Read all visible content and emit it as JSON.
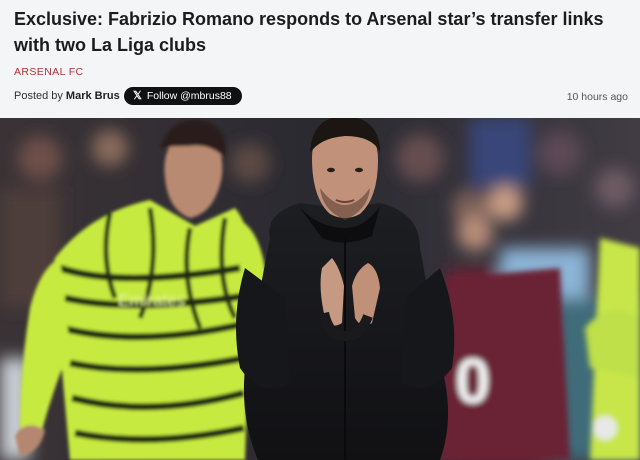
{
  "article": {
    "headline": "Exclusive: Fabrizio Romano responds to Arsenal star’s transfer links with two La Liga clubs",
    "category": "ARSENAL FC",
    "byline_prefix": "Posted by",
    "author": "Mark Brus",
    "follow_button_label": "Follow @mbrus88",
    "follow_button_icon": "x-logo-icon",
    "timestamp": "10 hours ago"
  },
  "hero_image": {
    "kit_text": "Emirates",
    "shirt_number": "0"
  },
  "colors": {
    "category": "#b03238",
    "header_background": "#f4f5f6",
    "follow_button_background": "#111111",
    "kit_yellow": "#c7ea3f"
  }
}
